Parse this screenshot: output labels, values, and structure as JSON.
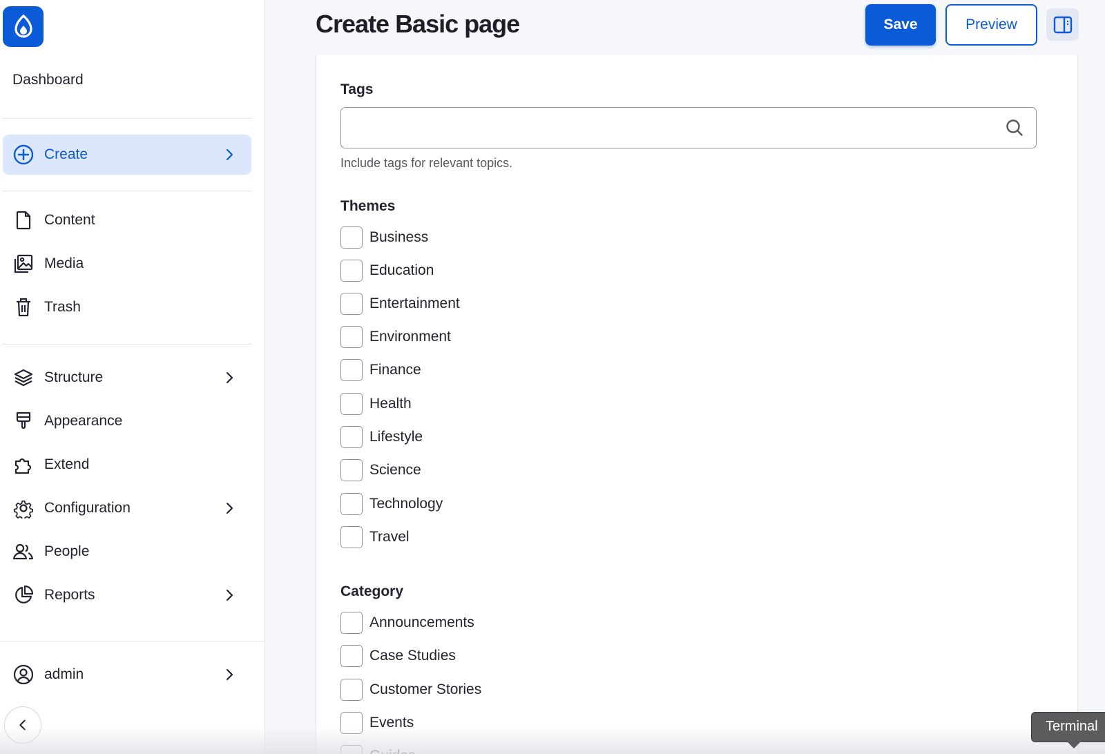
{
  "sidebar": {
    "dashboard_label": "Dashboard",
    "create_label": "Create",
    "items_top": [
      {
        "label": "Content",
        "icon": "file-icon"
      },
      {
        "label": "Media",
        "icon": "image-icon"
      },
      {
        "label": "Trash",
        "icon": "trash-icon"
      }
    ],
    "structure_label": "Structure",
    "appearance_label": "Appearance",
    "extend_label": "Extend",
    "configuration_label": "Configuration",
    "people_label": "People",
    "reports_label": "Reports",
    "user_label": "admin"
  },
  "header": {
    "title": "Create Basic page",
    "save_label": "Save",
    "preview_label": "Preview"
  },
  "form": {
    "tags": {
      "label": "Tags",
      "value": "",
      "help": "Include tags for relevant topics."
    },
    "themes": {
      "label": "Themes",
      "options": [
        "Business",
        "Education",
        "Entertainment",
        "Environment",
        "Finance",
        "Health",
        "Lifestyle",
        "Science",
        "Technology",
        "Travel"
      ]
    },
    "category": {
      "label": "Category",
      "options": [
        "Announcements",
        "Case Studies",
        "Customer Stories",
        "Events",
        "Guides"
      ]
    }
  },
  "tooltip": {
    "text": "Terminal"
  },
  "colors": {
    "accent": "#0b5bd9",
    "active_bg": "#dde7fb"
  }
}
